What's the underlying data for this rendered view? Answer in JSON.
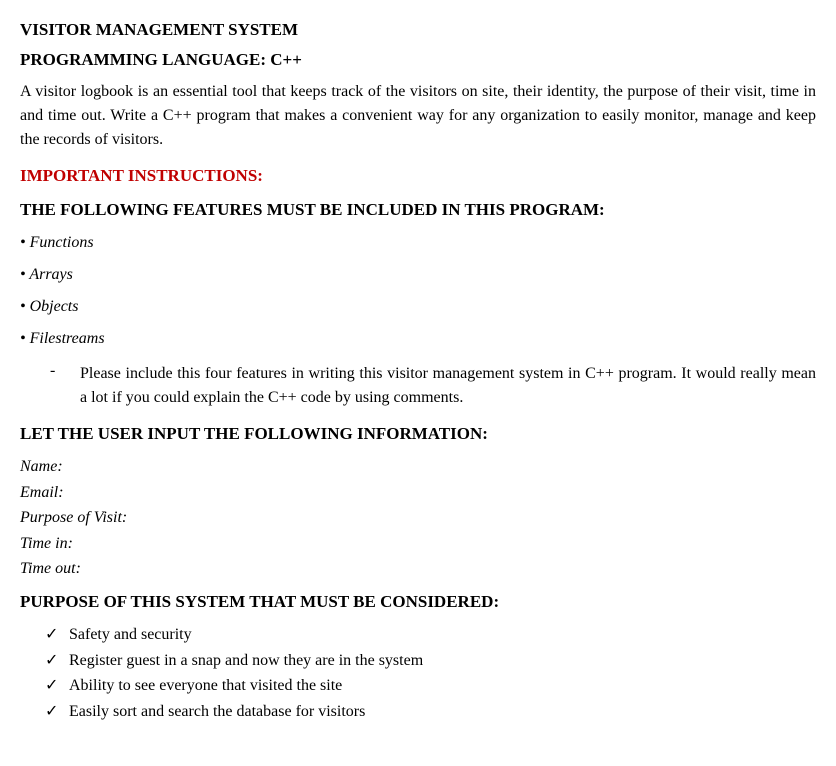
{
  "title": "VISITOR MANAGEMENT SYSTEM",
  "lang_line": "PROGRAMMING LANGUAGE: C++",
  "intro": "A visitor logbook is an essential tool that keeps track of the visitors on site, their identity, the purpose of their visit, time in and time out. Write a C++ program that  makes a convenient way for any organization to easily monitor, manage and keep the records of visitors.",
  "important_heading": "IMPORTANT INSTRUCTIONS:",
  "features_heading": "THE FOLLOWING FEATURES MUST BE INCLUDED IN THIS PROGRAM:",
  "features": [
    "• Functions",
    "• Arrays",
    "• Objects",
    "• Filestreams"
  ],
  "note_dash": "-",
  "note_text": "Please include this four features in writing this visitor management system in C++ program. It would really mean a lot if you could explain the C++ code by using comments.",
  "input_heading": "LET THE USER INPUT THE FOLLOWING INFORMATION:",
  "input_fields": [
    "Name:",
    "Email:",
    "Purpose of Visit:",
    "Time in:",
    "Time out:"
  ],
  "purpose_heading": "PURPOSE OF THIS SYSTEM THAT MUST BE CONSIDERED:",
  "check_mark": "✓",
  "purposes": [
    "Safety and security",
    "Register guest in a snap and now they are in the system",
    "Ability to see everyone that visited the site",
    "Easily sort and search the database for visitors"
  ]
}
